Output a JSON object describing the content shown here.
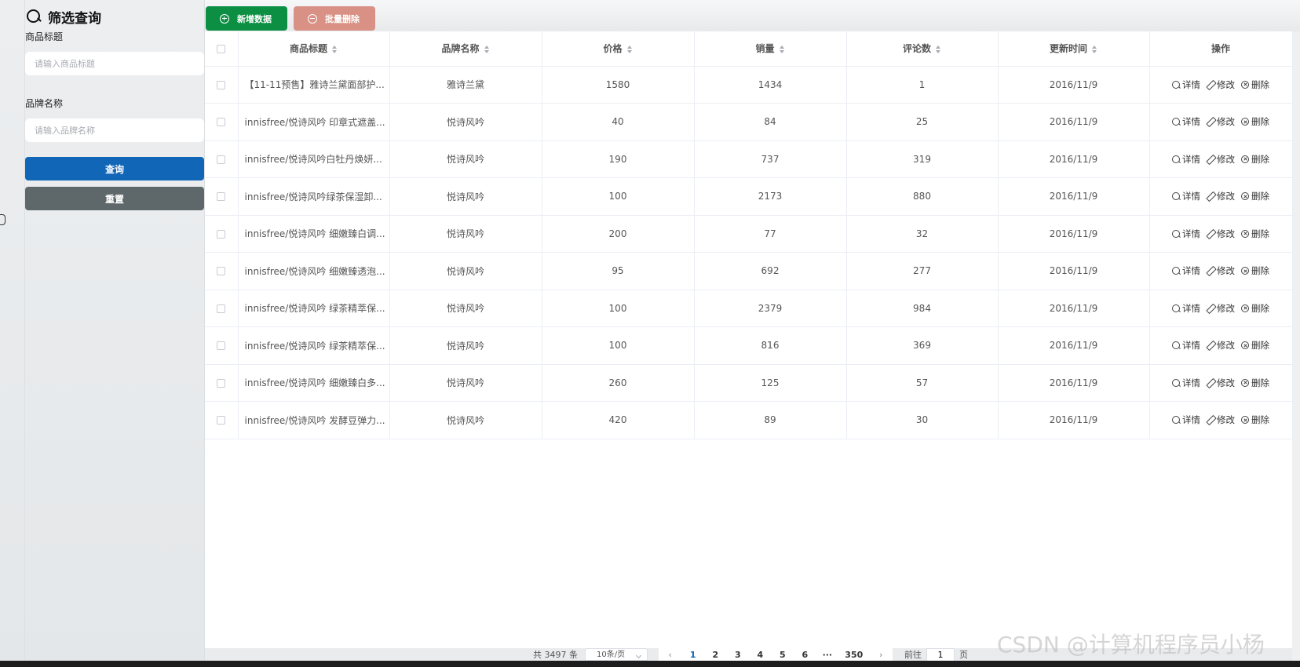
{
  "filter": {
    "title": "筛选查询",
    "fields": [
      {
        "label": "商品标题",
        "placeholder": "请输入商品标题"
      },
      {
        "label": "品牌名称",
        "placeholder": "请输入品牌名称"
      }
    ],
    "query_label": "查询",
    "reset_label": "重置"
  },
  "toolbar": {
    "add_label": "新增数据",
    "batch_delete_label": "批量删除"
  },
  "table": {
    "headers": [
      "商品标题",
      "品牌名称",
      "价格",
      "销量",
      "评论数",
      "更新时间",
      "操作"
    ],
    "actions": {
      "detail": "详情",
      "edit": "修改",
      "delete": "删除"
    },
    "rows": [
      {
        "title": "【11-11预售】雅诗兰黛面部护...",
        "brand": "雅诗兰黛",
        "price": "1580",
        "sales": "1434",
        "comments": "1",
        "updated": "2016/11/9"
      },
      {
        "title": "innisfree/悦诗风吟 印章式遮盖...",
        "brand": "悦诗风吟",
        "price": "40",
        "sales": "84",
        "comments": "25",
        "updated": "2016/11/9"
      },
      {
        "title": "innisfree/悦诗风吟白牡丹焕妍...",
        "brand": "悦诗风吟",
        "price": "190",
        "sales": "737",
        "comments": "319",
        "updated": "2016/11/9"
      },
      {
        "title": "innisfree/悦诗风吟绿茶保湿卸...",
        "brand": "悦诗风吟",
        "price": "100",
        "sales": "2173",
        "comments": "880",
        "updated": "2016/11/9"
      },
      {
        "title": "innisfree/悦诗风吟 细嫩臻白调...",
        "brand": "悦诗风吟",
        "price": "200",
        "sales": "77",
        "comments": "32",
        "updated": "2016/11/9"
      },
      {
        "title": "innisfree/悦诗风吟 细嫩臻透泡...",
        "brand": "悦诗风吟",
        "price": "95",
        "sales": "692",
        "comments": "277",
        "updated": "2016/11/9"
      },
      {
        "title": "innisfree/悦诗风吟 绿茶精萃保...",
        "brand": "悦诗风吟",
        "price": "100",
        "sales": "2379",
        "comments": "984",
        "updated": "2016/11/9"
      },
      {
        "title": "innisfree/悦诗风吟 绿茶精萃保...",
        "brand": "悦诗风吟",
        "price": "100",
        "sales": "816",
        "comments": "369",
        "updated": "2016/11/9"
      },
      {
        "title": "innisfree/悦诗风吟 细嫩臻白多...",
        "brand": "悦诗风吟",
        "price": "260",
        "sales": "125",
        "comments": "57",
        "updated": "2016/11/9"
      },
      {
        "title": "innisfree/悦诗风吟 发酵豆弹力...",
        "brand": "悦诗风吟",
        "price": "420",
        "sales": "89",
        "comments": "30",
        "updated": "2016/11/9"
      }
    ]
  },
  "pagination": {
    "total_text": "共 3497 条",
    "page_size": "10条/页",
    "pages": [
      "1",
      "2",
      "3",
      "4",
      "5",
      "6",
      "···",
      "350"
    ],
    "current_page": "1",
    "goto_prefix": "前往",
    "goto_value": "1",
    "goto_suffix": "页"
  },
  "watermark": "CSDN @计算机程序员小杨",
  "colors": {
    "primary": "#1166b8",
    "success": "#0c8f43",
    "danger_light": "#d89184",
    "reset": "#5e6769"
  }
}
